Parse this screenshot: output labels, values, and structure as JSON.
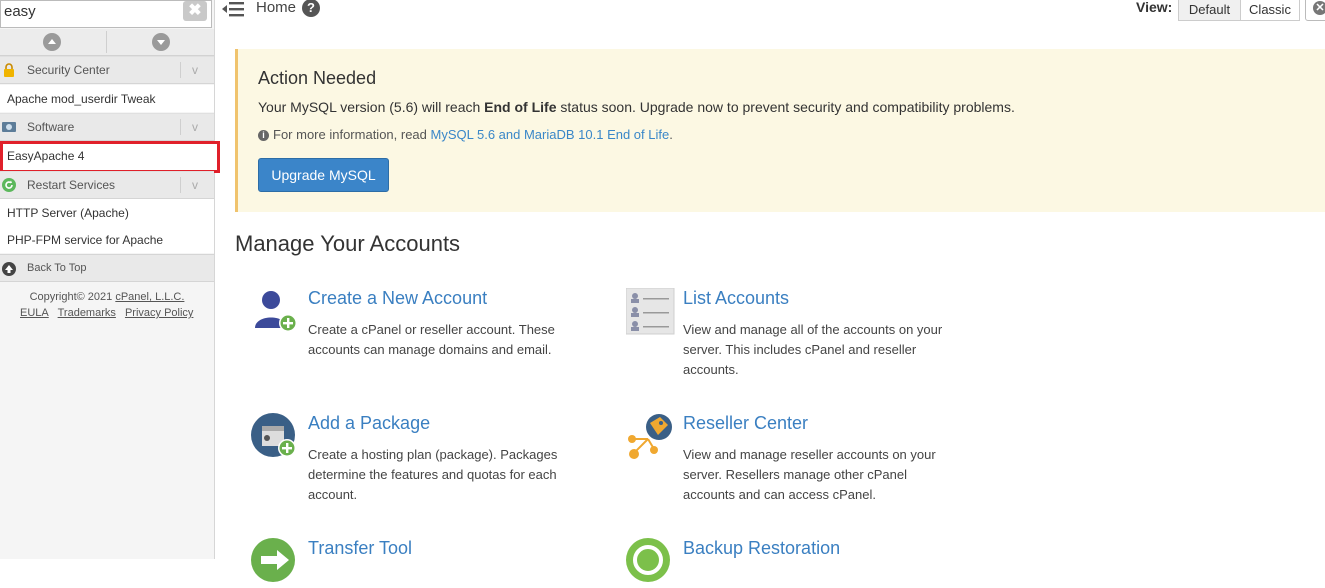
{
  "sidebar": {
    "search": {
      "value": "easy",
      "clear_label": "✖"
    },
    "categories": [
      {
        "label": "Security Center",
        "chevron": "v",
        "icon": "lock-icon",
        "items": [
          "Apache mod_userdir Tweak"
        ]
      },
      {
        "label": "Software",
        "chevron": "v",
        "icon": "software-icon",
        "items": [
          "EasyApache 4"
        ]
      },
      {
        "label": "Restart Services",
        "chevron": "v",
        "icon": "restart-icon",
        "items": [
          "HTTP Server (Apache)",
          "PHP-FPM service for Apache"
        ]
      }
    ],
    "back_to_top": "Back To Top",
    "copyright_prefix": "Copyright© 2021 ",
    "copyright_link": "cPanel, L.L.C.",
    "legal": [
      "EULA",
      "Trademarks",
      "Privacy Policy"
    ]
  },
  "topbar": {
    "home": "Home",
    "help": "?",
    "view_label": "View:",
    "view_default": "Default",
    "view_classic": "Classic"
  },
  "alert": {
    "title": "Action Needed",
    "message_pre": "Your MySQL version (5.6) will reach ",
    "message_bold": "End of Life",
    "message_post": " status soon. Upgrade now to prevent security and compatibility problems.",
    "info_icon": "i",
    "info_pre": "For more information, read ",
    "info_link": "MySQL 5.6 and MariaDB 10.1 End of Life",
    "info_post": ".",
    "button": "Upgrade MySQL"
  },
  "section": {
    "title": "Manage Your Accounts",
    "features": {
      "create": {
        "title": "Create a New Account",
        "desc": "Create a cPanel or reseller account. These accounts can manage domains and email."
      },
      "list": {
        "title": "List Accounts",
        "desc": "View and manage all of the accounts on your server. This includes cPanel and reseller accounts."
      },
      "package": {
        "title": "Add a Package",
        "desc": "Create a hosting plan (package). Packages determine the features and quotas for each account."
      },
      "reseller": {
        "title": "Reseller Center",
        "desc": "View and manage reseller accounts on your server. Resellers manage other cPanel accounts and can access cPanel."
      },
      "transfer": {
        "title": "Transfer Tool",
        "desc": ""
      },
      "backup": {
        "title": "Backup Restoration",
        "desc": ""
      }
    }
  },
  "colors": {
    "link_blue": "#3a7fc1",
    "highlight_red": "#e0202a",
    "alert_bg": "#fcf8e3",
    "button_blue": "#3b85c9"
  }
}
